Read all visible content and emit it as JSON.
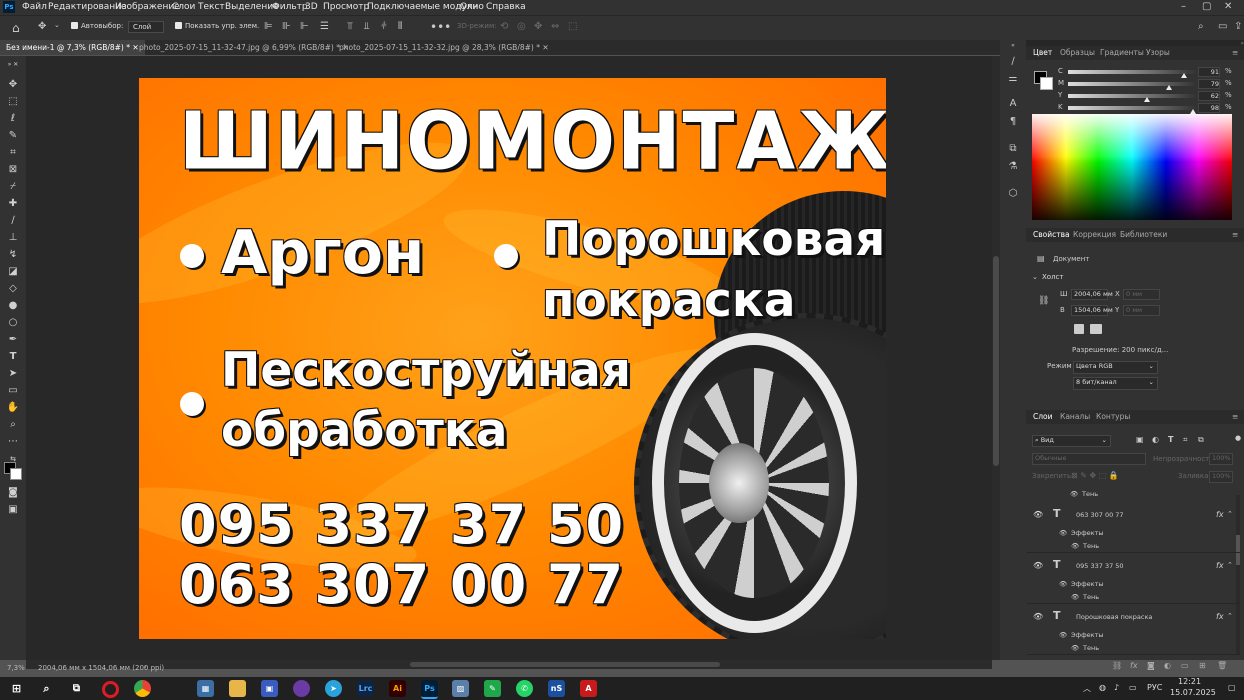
{
  "menu": {
    "app_icon": "Ps",
    "items": [
      "Файл",
      "Редактирование",
      "Изображение",
      "Слои",
      "Текст",
      "Выделение",
      "Фильтр",
      "3D",
      "Просмотр",
      "Подключаемые модули",
      "Окно",
      "Справка"
    ]
  },
  "options": {
    "autoselect_label": "Автовыбор:",
    "autoselect_value": "Слой",
    "show_controls_label": "Показать упр. элем.",
    "mode_3d_label": "3D-режим:"
  },
  "tabs": [
    {
      "label": "Без имени-1 @ 7,3% (RGB/8#) *",
      "active": true
    },
    {
      "label": "photo_2025-07-15_11-32-47.jpg @ 6,99% (RGB/8#) *",
      "active": false
    },
    {
      "label": "photo_2025-07-15_11-32-32.jpg @ 28,3% (RGB/8#) *",
      "active": false
    }
  ],
  "document": {
    "title": "ШИНОМОНТАЖ",
    "service_1": "Аргон",
    "service_2_line1": "Порошковая",
    "service_2_line2": "покраска",
    "service_3_line1": "Пескоструйная",
    "service_3_line2": "обработка",
    "phone_1": "095 337 37 50",
    "phone_2": "063 307 00 77"
  },
  "status": {
    "zoom": "7,3%",
    "doc_size": "2004,06 мм x 1504,06 мм (200 ppi)"
  },
  "color_panel": {
    "tabs": [
      "Цвет",
      "Образцы",
      "Градиенты",
      "Узоры"
    ],
    "sliders": [
      {
        "label": "C",
        "value": "91",
        "unit": "%",
        "level": 0.91
      },
      {
        "label": "M",
        "value": "79",
        "unit": "%",
        "level": 0.79
      },
      {
        "label": "Y",
        "value": "62",
        "unit": "%",
        "level": 0.62
      },
      {
        "label": "K",
        "value": "98",
        "unit": "%",
        "level": 0.98
      }
    ]
  },
  "properties_panel": {
    "tabs": [
      "Свойства",
      "Коррекция",
      "Библиотеки"
    ],
    "doc_label": "Документ",
    "section": "Холст",
    "w_label": "Ш",
    "w_value": "2004,06 мм",
    "x_label": "X",
    "x_value": "0 мм",
    "h_label": "В",
    "h_value": "1504,06 мм",
    "y_label": "Y",
    "y_value": "0 мм",
    "resolution": "Разрешение: 200 пикс/д...",
    "mode_label": "Режим",
    "mode_value": "Цвета RGB",
    "depth_value": "8 бит/канал"
  },
  "layers_panel": {
    "tabs": [
      "Слои",
      "Каналы",
      "Контуры"
    ],
    "filter_value": "Вид",
    "blend_value": "Обычные",
    "opacity_label": "Непрозрачность:",
    "opacity_value": "100%",
    "lock_label": "Закрепить:",
    "fill_label": "Заливка:",
    "fill_value": "100%",
    "top_sub": "Тень",
    "layers": [
      {
        "name": "063 307 00 77",
        "effects": "Эффекты",
        "shadow": "Тень"
      },
      {
        "name": "095 337 37 50",
        "effects": "Эффекты",
        "shadow": "Тень"
      },
      {
        "name": "Порошковая покраска",
        "effects": "Эффекты",
        "shadow": "Тень"
      }
    ]
  },
  "taskbar": {
    "lang": "РУС",
    "time": "12:21",
    "date": "15.07.2025",
    "apps": [
      "windows-icon",
      "search-icon",
      "task-view-icon",
      "opera-icon",
      "chrome-icon",
      "calculator-icon",
      "folder-icon",
      "save-icon",
      "app-icon",
      "telegram-icon",
      "lightroom-icon",
      "illustrator-icon",
      "photoshop-icon",
      "gallery-icon",
      "app-green-icon",
      "whatsapp-icon",
      "ns-icon",
      "acrobat-icon"
    ]
  },
  "colors": {
    "orange": "#ff8a00",
    "ps_blue": "#31a8ff",
    "panel": "#323232"
  }
}
